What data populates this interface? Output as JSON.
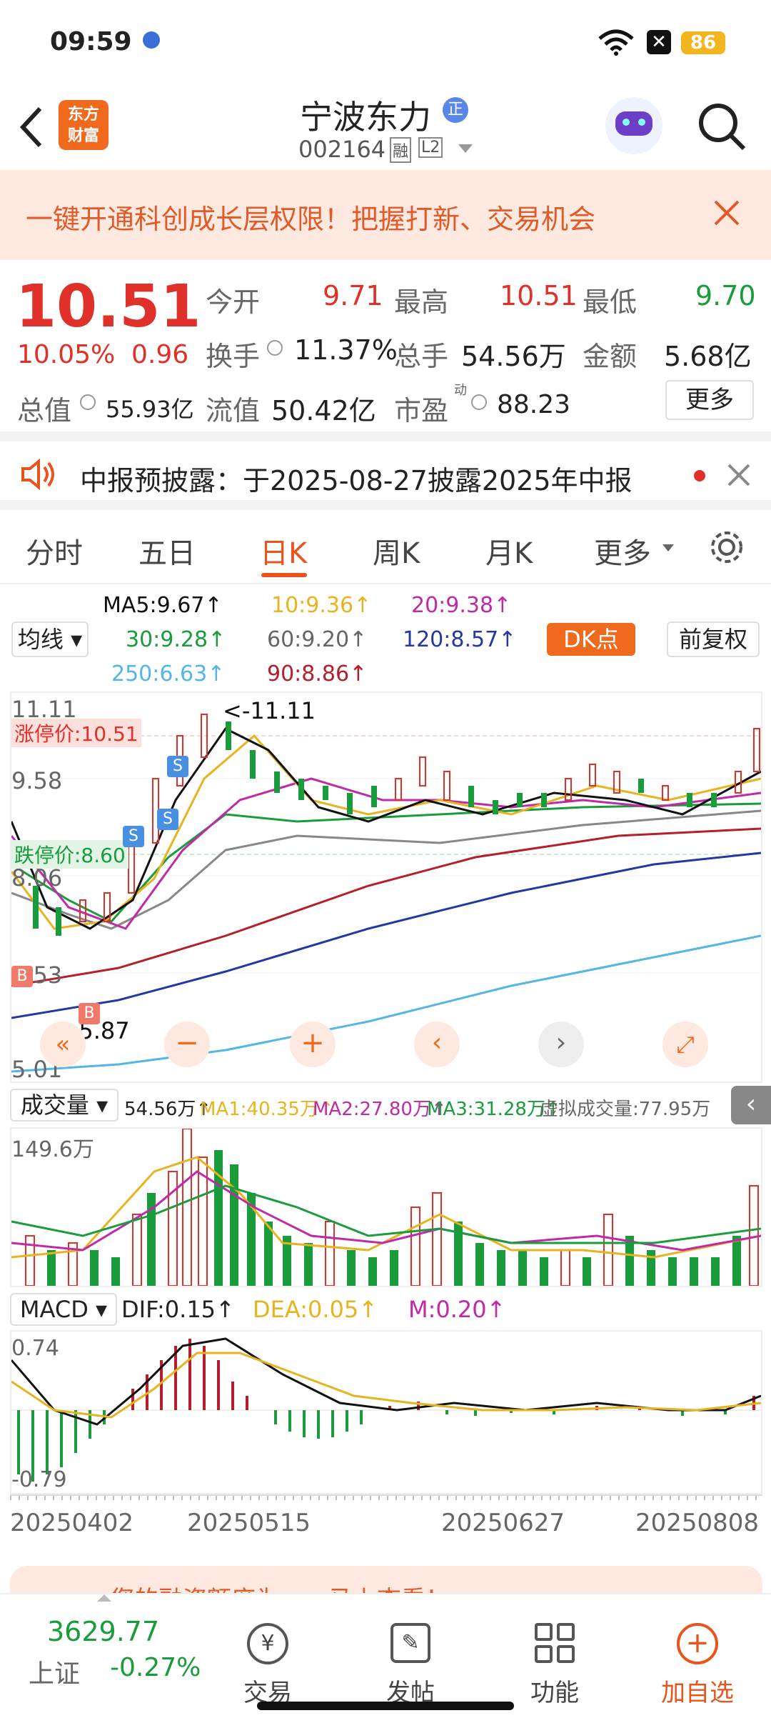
{
  "status_bar": {
    "time": "09:59",
    "battery": "86"
  },
  "header": {
    "title": "宁波东力",
    "badge": "正",
    "code": "002164",
    "margin_tag": "融",
    "level_tag": "L2",
    "logo_line1": "东方",
    "logo_line2": "财富"
  },
  "banner": {
    "text": "一键开通科创成长层权限！把握打新、交易机会"
  },
  "quote": {
    "price": "10.51",
    "change_pct": "10.05%",
    "change": "0.96",
    "open_label": "今开",
    "open": "9.71",
    "high_label": "最高",
    "high": "10.51",
    "low_label": "最低",
    "low": "9.70",
    "turnover_label": "换手",
    "turnover": "11.37%",
    "volume_label": "总手",
    "volume": "54.56万",
    "amount_label": "金额",
    "amount": "5.68亿",
    "mktcap_label": "总值",
    "mktcap": "55.93亿",
    "float_label": "流值",
    "float": "50.42亿",
    "pe_label": "市盈",
    "pe_sup": "动",
    "pe": "88.23",
    "more": "更多"
  },
  "notice": {
    "text": "中报预披露：于2025-08-27披露2025年中报"
  },
  "tabs": [
    "分时",
    "五日",
    "日K",
    "周K",
    "月K",
    "更多"
  ],
  "ma_panel": {
    "selector": "均线",
    "ma5": "MA5:9.67↑",
    "ma10": "10:9.36↑",
    "ma20": "20:9.38↑",
    "ma30": "30:9.28↑",
    "ma60": "60:9.20↑",
    "ma120": "120:8.57↑",
    "ma250": "250:6.63↑",
    "ma90": "90:8.86↑",
    "dk": "DK点",
    "adjust": "前复权"
  },
  "kchart": {
    "y_top": "11.11",
    "y_mid": "9.58",
    "y_low": "8.06",
    "y_low2": "6.53",
    "y_bottom": "5.01",
    "limit_up": "涨停价:10.51",
    "limit_down": "跌停价:8.60",
    "max_label": "<-11.11",
    "min_label": "<-5.87"
  },
  "volume_panel": {
    "selector": "成交量",
    "vol": "54.56万↑",
    "ma1": "MA1:40.35万↑",
    "ma2": "MA2:27.80万↑",
    "ma3": "MA3:31.28万↑",
    "virtual": "虚拟成交量:77.95万",
    "y_top": "149.6万"
  },
  "macd_panel": {
    "selector": "MACD",
    "dif": "DIF:0.15↑",
    "dea": "DEA:0.05↑",
    "m": "M:0.20↑",
    "y_top": "0.74",
    "y_bottom": "-0.79"
  },
  "dates": [
    "20250402",
    "20250515",
    "20250627",
    "20250808"
  ],
  "promo": {
    "text": "您的融资额度为……马上查看！"
  },
  "bottom_nav": {
    "index_value": "3629.77",
    "index_name": "上证",
    "index_change": "-0.27%",
    "items": [
      "交易",
      "发帖",
      "功能",
      "加自选"
    ]
  }
}
